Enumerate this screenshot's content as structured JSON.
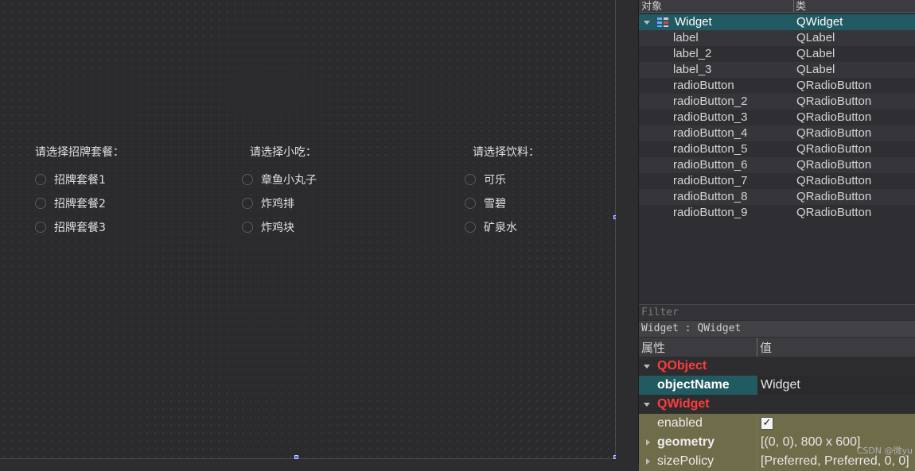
{
  "form": {
    "group_labels": [
      "请选择招牌套餐：",
      "请选择小吃：",
      "请选择饮料："
    ],
    "groups": [
      [
        "招牌套餐1",
        "招牌套餐2",
        "招牌套餐3"
      ],
      [
        "章鱼小丸子",
        "炸鸡排",
        "炸鸡块"
      ],
      [
        "可乐",
        "雪碧",
        "矿泉水"
      ]
    ]
  },
  "object_inspector": {
    "headers": [
      "对象",
      "类"
    ],
    "rows": [
      {
        "name": "Widget",
        "class": "QWidget"
      },
      {
        "name": "label",
        "class": "QLabel"
      },
      {
        "name": "label_2",
        "class": "QLabel"
      },
      {
        "name": "label_3",
        "class": "QLabel"
      },
      {
        "name": "radioButton",
        "class": "QRadioButton"
      },
      {
        "name": "radioButton_2",
        "class": "QRadioButton"
      },
      {
        "name": "radioButton_3",
        "class": "QRadioButton"
      },
      {
        "name": "radioButton_4",
        "class": "QRadioButton"
      },
      {
        "name": "radioButton_5",
        "class": "QRadioButton"
      },
      {
        "name": "radioButton_6",
        "class": "QRadioButton"
      },
      {
        "name": "radioButton_7",
        "class": "QRadioButton"
      },
      {
        "name": "radioButton_8",
        "class": "QRadioButton"
      },
      {
        "name": "radioButton_9",
        "class": "QRadioButton"
      }
    ]
  },
  "property_editor": {
    "filter_placeholder": "Filter",
    "class_line": "Widget : QWidget",
    "headers": [
      "属性",
      "值"
    ],
    "sections": {
      "qobject": "QObject",
      "qwidget": "QWidget"
    },
    "props": {
      "objectName": {
        "name": "objectName",
        "value": "Widget"
      },
      "enabled": {
        "name": "enabled",
        "value": "✓"
      },
      "geometry": {
        "name": "geometry",
        "value": "[(0, 0), 800 x 600]"
      },
      "sizePolicy": {
        "name": "sizePolicy",
        "value": "[Preferred, Preferred, 0, 0]"
      }
    }
  },
  "watermark": "CSDN @微yu",
  "colors": {
    "selection": "#215a63",
    "section_red": "#ff3b3b",
    "olive_row": "#6f6c4a",
    "handle": "#3f5fff"
  }
}
